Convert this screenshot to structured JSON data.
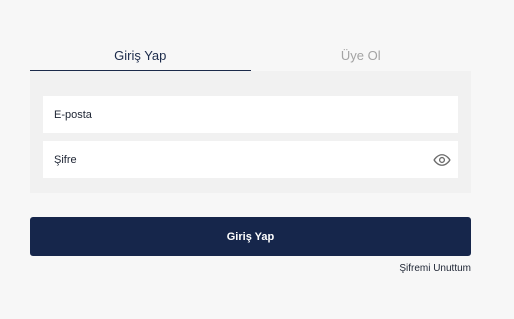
{
  "tabs": [
    {
      "label": "Giriş Yap",
      "active": true
    },
    {
      "label": "Üye Ol",
      "active": false
    }
  ],
  "form": {
    "email_placeholder": "E-posta",
    "password_placeholder": "Şifre",
    "password_toggle_icon": "eye-icon",
    "submit_label": "Giriş Yap",
    "forgot_label": "Şifremi Unuttum"
  },
  "colors": {
    "primary": "#16264b",
    "background": "#f7f7f7",
    "inactive_tab": "#a3a3a3"
  }
}
